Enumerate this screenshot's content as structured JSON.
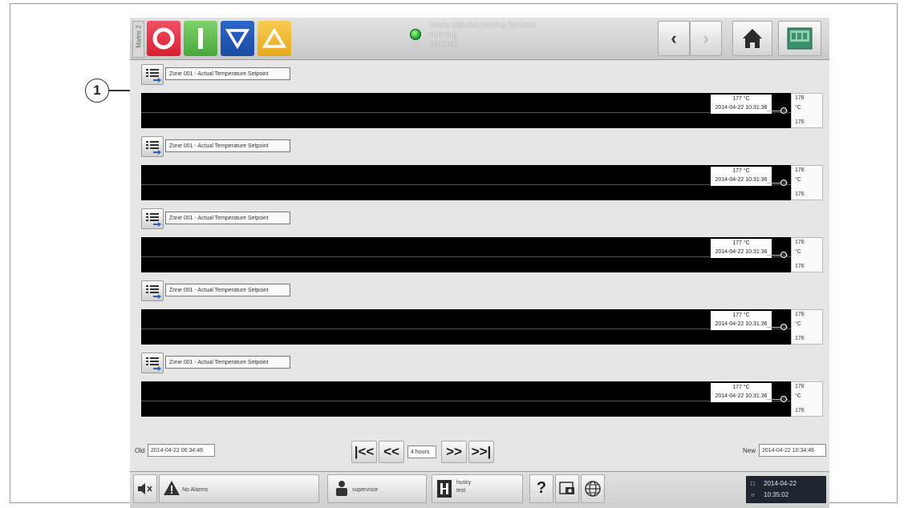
{
  "callout": {
    "number": "1"
  },
  "topbar": {
    "matrix_label": "Matrix 2",
    "machine_name": "Husky Injection Molding Systems",
    "machine_state": "Running",
    "cycle_time": "00:00:00",
    "unit": "°C",
    "status_color": "#22b02e",
    "button_colors": {
      "stop": "#e23346",
      "start": "#5ebd4a",
      "down": "#2457b8",
      "alarm": "#f0bb2f"
    }
  },
  "trends": [
    {
      "label": "Zone 001 - Actual Temperature Setpoint",
      "value": "177 °C",
      "timestamp": "2014-04-22 10:31:36",
      "axis_max": "178",
      "axis_unit": "°C",
      "axis_min": "176"
    },
    {
      "label": "Zone 001 - Actual Temperature Setpoint",
      "value": "177 °C",
      "timestamp": "2014-04-22 10:31:36",
      "axis_max": "178",
      "axis_unit": "°C",
      "axis_min": "176"
    },
    {
      "label": "Zone 001 - Actual Temperature Setpoint",
      "value": "177 °C",
      "timestamp": "2014-04-22 10:31:36",
      "axis_max": "178",
      "axis_unit": "°C",
      "axis_min": "176"
    },
    {
      "label": "Zone 001 - Actual Temperature Setpoint",
      "value": "177 °C",
      "timestamp": "2014-04-22 10:31:36",
      "axis_max": "178",
      "axis_unit": "°C",
      "axis_min": "176"
    },
    {
      "label": "Zone 001 - Actual Temperature Setpoint",
      "value": "177 °C",
      "timestamp": "2014-04-22 10:31:36",
      "axis_max": "178",
      "axis_unit": "°C",
      "axis_min": "176"
    }
  ],
  "timeline": {
    "old_label": "Old",
    "old_value": "2014-04-22 06:34:46",
    "range_value": "4 hours",
    "new_label": "New",
    "new_value": "2014-04-22 10:34:46",
    "first_icon": "|<<",
    "prev_icon": "<<",
    "next_icon": ">>",
    "last_icon": ">>|"
  },
  "statusbar": {
    "alarms": "No Alarms",
    "user": "supervisor",
    "mold_name": "husky",
    "mold_sub": "test",
    "help": "?",
    "date": "2014-04-22",
    "time": "10:35:02"
  }
}
